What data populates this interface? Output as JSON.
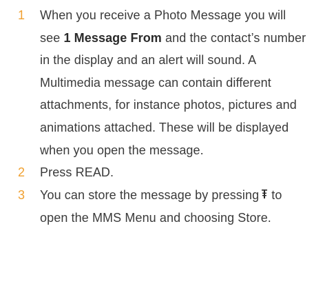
{
  "steps": [
    {
      "number": "1",
      "text_before": "When you receive a Photo Message you will see ",
      "bold": "1 Message From",
      "text_after": " and the contact’s number in the display and an alert will sound. A Multimedia message can contain different attachments, for instance photos, pictures and animations attached. These will be displayed when you open the message."
    },
    {
      "number": "2",
      "text": "Press READ."
    },
    {
      "number": "3",
      "text_before": "You can store the message by pressing",
      "icon": "menu-key-icon",
      "text_after": "to open the MMS Menu and choosing Store."
    }
  ],
  "colors": {
    "step_number": "#f0a030",
    "text": "#3a3a3a"
  }
}
